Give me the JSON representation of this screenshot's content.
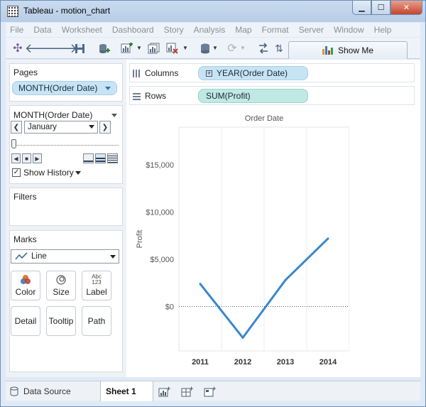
{
  "window": {
    "title": "Tableau - motion_chart",
    "min_label": "▁",
    "max_label": "☐",
    "close_label": "✕"
  },
  "menu": [
    "File",
    "Data",
    "Worksheet",
    "Dashboard",
    "Story",
    "Analysis",
    "Map",
    "Format",
    "Server",
    "Window",
    "Help"
  ],
  "toolbar": {
    "show_me_label": "Show Me",
    "icons": [
      "tableau-logo-icon",
      "undo-icon",
      "redo-icon",
      "save-icon",
      "add-datasource-icon",
      "new-worksheet-icon",
      "duplicate-sheet-icon",
      "clear-sheet-icon",
      "datasource-icon",
      "refresh-icon",
      "swap-icon",
      "sort-icon"
    ]
  },
  "pages": {
    "title": "Pages",
    "pill": "MONTH(Order Date)"
  },
  "page_control": {
    "title": "MONTH(Order Date)",
    "selected": "January",
    "show_history_label": "Show History"
  },
  "filters": {
    "title": "Filters"
  },
  "marks": {
    "title": "Marks",
    "type": "Line",
    "buttons": {
      "color": "Color",
      "size": "Size",
      "label": "Label",
      "label_icon_text": "Abc 123",
      "detail": "Detail",
      "tooltip": "Tooltip",
      "path": "Path"
    }
  },
  "shelves": {
    "columns_label": "Columns",
    "columns_pill": "YEAR(Order Date)",
    "rows_label": "Rows",
    "rows_pill": "SUM(Profit)"
  },
  "bottom": {
    "data_source": "Data Source",
    "sheet": "Sheet 1"
  },
  "colors": {
    "line": "#3a87cc",
    "pill_blue": "#c7e4f5",
    "pill_green": "#bfe9e2"
  },
  "chart_data": {
    "type": "line",
    "title": "Order Date",
    "xlabel": "",
    "ylabel": "Profit",
    "categories": [
      "2011",
      "2012",
      "2013",
      "2014"
    ],
    "values": [
      2400,
      -3300,
      2800,
      7200
    ],
    "yticks": [
      0,
      5000,
      10000,
      15000
    ],
    "ytick_labels": [
      "$0",
      "$5,000",
      "$10,000",
      "$15,000"
    ],
    "ylim": [
      -4700,
      19000
    ],
    "grid": false,
    "zero_line": "dotted"
  }
}
